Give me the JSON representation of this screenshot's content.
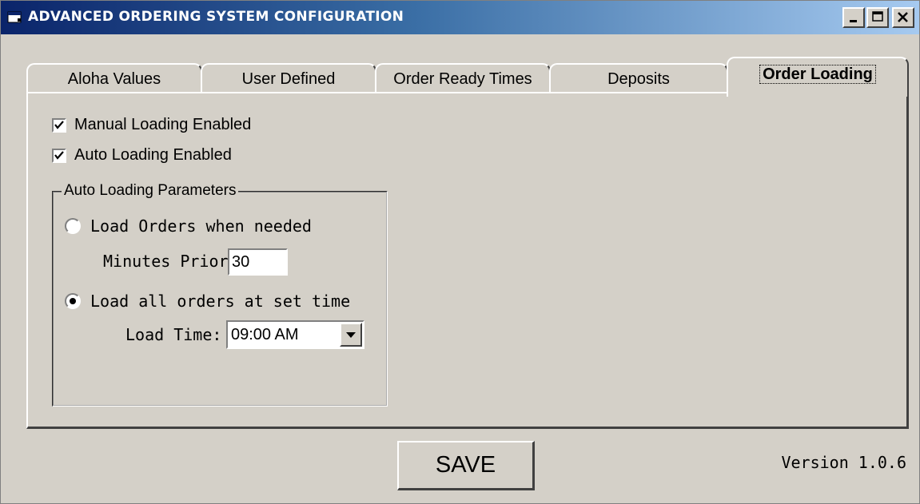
{
  "window": {
    "title": "ADVANCED ORDERING SYSTEM CONFIGURATION",
    "icon": "app-window-icon",
    "controls": [
      "minimize-icon",
      "maximize-icon",
      "close-icon"
    ]
  },
  "tabs": [
    {
      "label": "Aloha Values",
      "active": false
    },
    {
      "label": "User Defined",
      "active": false
    },
    {
      "label": "Order Ready Times",
      "active": false
    },
    {
      "label": "Deposits",
      "active": false
    },
    {
      "label": "Order Loading",
      "active": true
    }
  ],
  "order_loading": {
    "manual_loading": {
      "label": "Manual Loading Enabled",
      "checked": true
    },
    "auto_loading": {
      "label": "Auto Loading Enabled",
      "checked": true
    },
    "group": {
      "title": "Auto Loading Parameters",
      "option_when_needed": {
        "label": "Load Orders when needed",
        "selected": false
      },
      "minutes_prior": {
        "label": "Minutes Prior:",
        "value": "30"
      },
      "option_set_time": {
        "label": "Load all orders at set time",
        "selected": true
      },
      "load_time": {
        "label": "Load Time:",
        "value": "09:00 AM"
      }
    }
  },
  "footer": {
    "save_label": "SAVE",
    "version": "Version 1.0.6"
  }
}
